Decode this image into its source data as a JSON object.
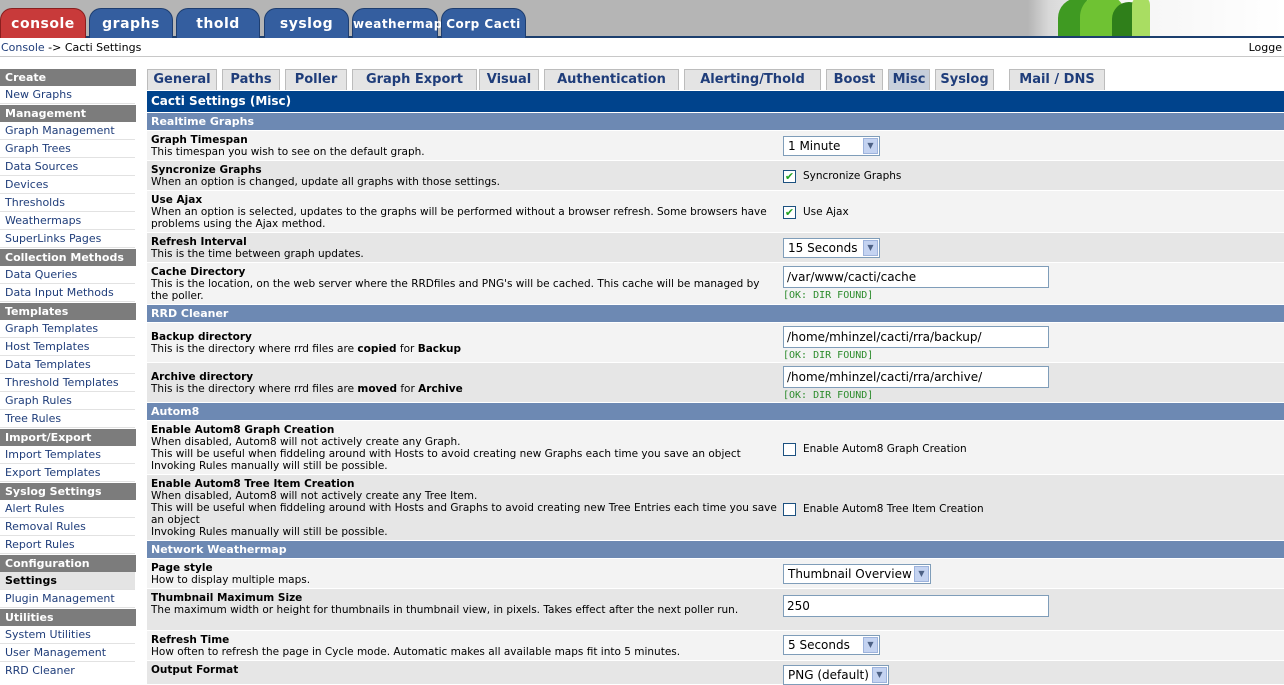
{
  "top_tabs": [
    {
      "label": "console",
      "active": true
    },
    {
      "label": "graphs"
    },
    {
      "label": "thold"
    },
    {
      "label": "syslog"
    },
    {
      "label": "weathermap"
    },
    {
      "label": "Corp Cacti"
    }
  ],
  "breadcrumb": {
    "link": "Console",
    "current": " -> Cacti Settings"
  },
  "logged_in_text": "Logge",
  "sidebar": {
    "sections": [
      {
        "header": "Create",
        "items": [
          "New Graphs"
        ]
      },
      {
        "header": "Management",
        "items": [
          "Graph Management",
          "Graph Trees",
          "Data Sources",
          "Devices",
          "Thresholds",
          "Weathermaps",
          "SuperLinks Pages"
        ]
      },
      {
        "header": "Collection Methods",
        "items": [
          "Data Queries",
          "Data Input Methods"
        ]
      },
      {
        "header": "Templates",
        "items": [
          "Graph Templates",
          "Host Templates",
          "Data Templates",
          "Threshold Templates",
          "Graph Rules",
          "Tree Rules"
        ]
      },
      {
        "header": "Import/Export",
        "items": [
          "Import Templates",
          "Export Templates"
        ]
      },
      {
        "header": "Syslog Settings",
        "items": [
          "Alert Rules",
          "Removal Rules",
          "Report Rules"
        ]
      },
      {
        "header": "Configuration",
        "items": [
          "Settings",
          "Plugin Management"
        ]
      },
      {
        "header": "Utilities",
        "items": [
          "System Utilities",
          "User Management",
          "RRD Cleaner"
        ]
      }
    ],
    "current_item": "Settings"
  },
  "settings_tabs": [
    "General",
    "Paths",
    "Poller",
    "Graph Export",
    "Visual",
    "Authentication",
    "Alerting/Thold",
    "Boost",
    "Misc",
    "Syslog",
    "Mail / DNS"
  ],
  "active_settings_tab": "Misc",
  "page_title": "Cacti Settings (Misc)",
  "sections": {
    "realtime": "Realtime Graphs",
    "rrd": "RRD Cleaner",
    "autom8": "Autom8",
    "weathermap": "Network Weathermap"
  },
  "settings": {
    "graph_timespan": {
      "label": "Graph Timespan",
      "desc": "This timespan you wish to see on the default graph.",
      "value": "1 Minute"
    },
    "sync_graphs": {
      "label": "Syncronize Graphs",
      "desc": "When an option is changed, update all graphs with those settings.",
      "checked": true,
      "checkbox_label": "Syncronize Graphs"
    },
    "use_ajax": {
      "label": "Use Ajax",
      "desc": "When an option is selected, updates to the graphs will be performed without a browser refresh. Some browsers have problems using the Ajax method.",
      "checked": true,
      "checkbox_label": "Use Ajax"
    },
    "refresh_interval": {
      "label": "Refresh Interval",
      "desc": "This is the time between graph updates.",
      "value": "15 Seconds"
    },
    "cache_dir": {
      "label": "Cache Directory",
      "desc": "This is the location, on the web server where the RRDfiles and PNG's will be cached. This cache will be managed by the poller.",
      "value": "/var/www/cacti/cache",
      "status": "[OK: DIR FOUND]"
    },
    "backup_dir": {
      "label": "Backup directory",
      "desc_prefix": "This is the directory where rrd files are ",
      "desc_bold1": "copied",
      "desc_mid": " for ",
      "desc_bold2": "Backup",
      "value": "/home/mhinzel/cacti/rra/backup/",
      "status": "[OK: DIR FOUND]"
    },
    "archive_dir": {
      "label": "Archive directory",
      "desc_prefix": "This is the directory where rrd files are ",
      "desc_bold1": "moved",
      "desc_mid": " for ",
      "desc_bold2": "Archive",
      "value": "/home/mhinzel/cacti/rra/archive/",
      "status": "[OK: DIR FOUND]"
    },
    "autom8_graph": {
      "label": "Enable Autom8 Graph Creation",
      "desc_lines": [
        "When disabled, Autom8 will not actively create any Graph.",
        "This will be useful when fiddeling around with Hosts to avoid creating new Graphs each time you save an object",
        "Invoking Rules manually will still be possible."
      ],
      "checked": false,
      "checkbox_label": "Enable Autom8 Graph Creation"
    },
    "autom8_tree": {
      "label": "Enable Autom8 Tree Item Creation",
      "desc_lines": [
        "When disabled, Autom8 will not actively create any Tree Item.",
        "This will be useful when fiddeling around with Hosts and Graphs to avoid creating new Tree Entries each time you save an object",
        "Invoking Rules manually will still be possible."
      ],
      "checked": false,
      "checkbox_label": "Enable Autom8 Tree Item Creation"
    },
    "page_style": {
      "label": "Page style",
      "desc": "How to display multiple maps.",
      "value": "Thumbnail Overview"
    },
    "thumb_size": {
      "label": "Thumbnail Maximum Size",
      "desc": "The maximum width or height for thumbnails in thumbnail view, in pixels. Takes effect after the next poller run.",
      "value": "250"
    },
    "refresh_time": {
      "label": "Refresh Time",
      "desc": "How often to refresh the page in Cycle mode. Automatic makes all available maps fit into 5 minutes.",
      "value": "5 Seconds"
    },
    "output_format": {
      "label": "Output Format",
      "value": "PNG (default)"
    }
  },
  "colors": {
    "title_bar": "#00438c",
    "section_bar": "#6d89b3",
    "active_top_tab": "#c83a3a",
    "top_tab": "#345e9f",
    "ok_status": "#2d8c2d"
  },
  "icons": {
    "check": "check-icon",
    "dropdown": "chevron-down-icon"
  }
}
